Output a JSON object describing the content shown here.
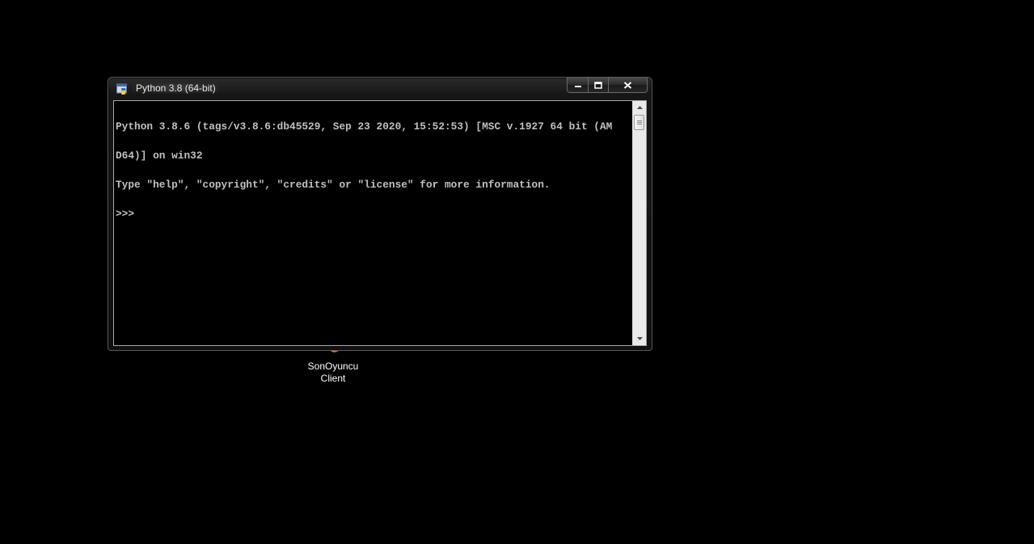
{
  "window": {
    "title": "Python 3.8 (64-bit)",
    "icon": "python-icon",
    "controls": {
      "minimize": "minimize-icon",
      "maximize": "maximize-icon",
      "close": "close-icon"
    }
  },
  "console": {
    "lines": [
      "Python 3.8.6 (tags/v3.8.6:db45529, Sep 23 2020, 15:52:53) [MSC v.1927 64 bit (AM",
      "D64)] on win32",
      "Type \"help\", \"copyright\", \"credits\" or \"license\" for more information.",
      ">>> "
    ]
  },
  "desktop": {
    "icons": [
      {
        "label": "SonOyuncu\nClient",
        "icon": "sonoyuncu-client-icon"
      }
    ]
  },
  "colors": {
    "desktop_background": "#000000",
    "console_background": "#000000",
    "console_text": "#c0c0c0",
    "scrollbar_track": "#eaeaea"
  }
}
